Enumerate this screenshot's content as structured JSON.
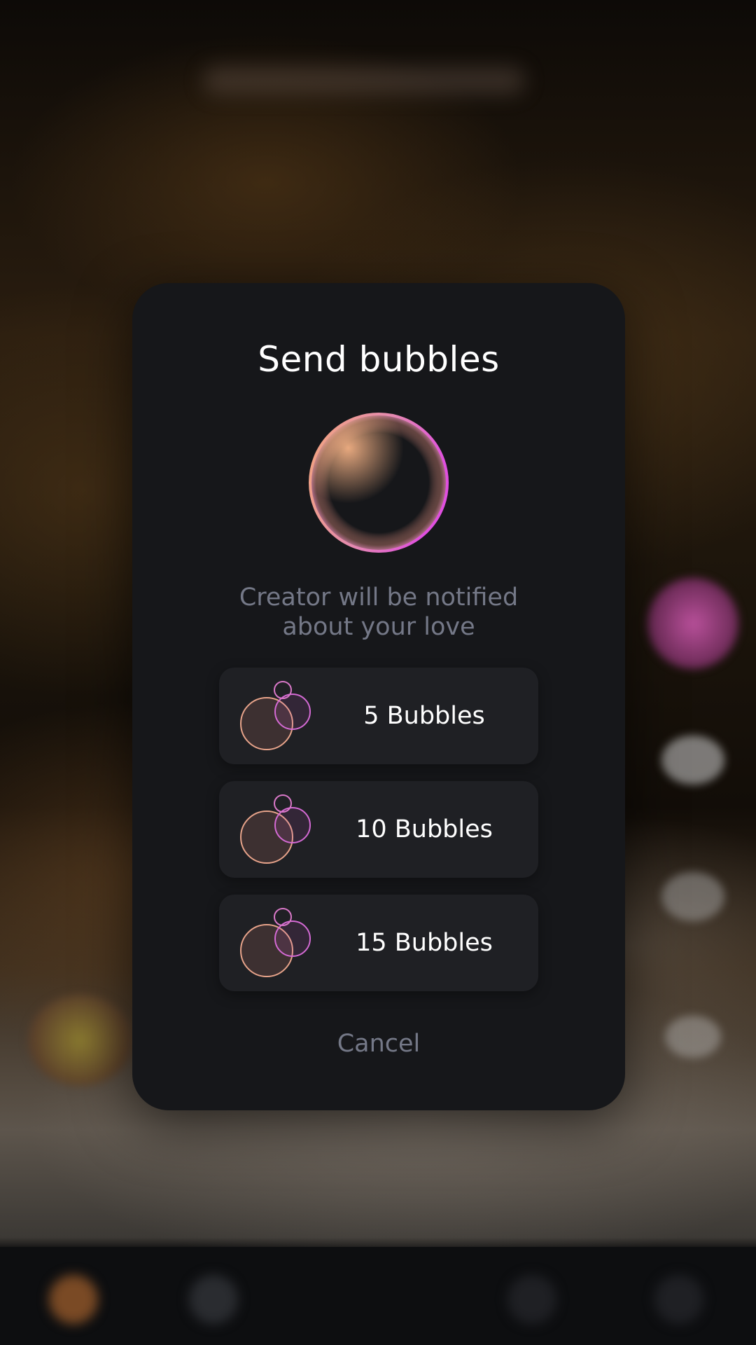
{
  "modal": {
    "title": "Send bubbles",
    "subtitle_line1": "Creator will be notified",
    "subtitle_line2": "about your love",
    "options": [
      {
        "label": "5 Bubbles",
        "icon": "bubbles-icon"
      },
      {
        "label": "10 Bubbles",
        "icon": "bubbles-icon"
      },
      {
        "label": "15 Bubbles",
        "icon": "bubbles-icon"
      }
    ],
    "cancel_label": "Cancel"
  },
  "colors": {
    "modal_bg": "#16171a",
    "option_bg": "#1f2024",
    "muted_text": "#747887",
    "bubble_orange": "#f0a07a",
    "bubble_magenta": "#e060e0"
  }
}
